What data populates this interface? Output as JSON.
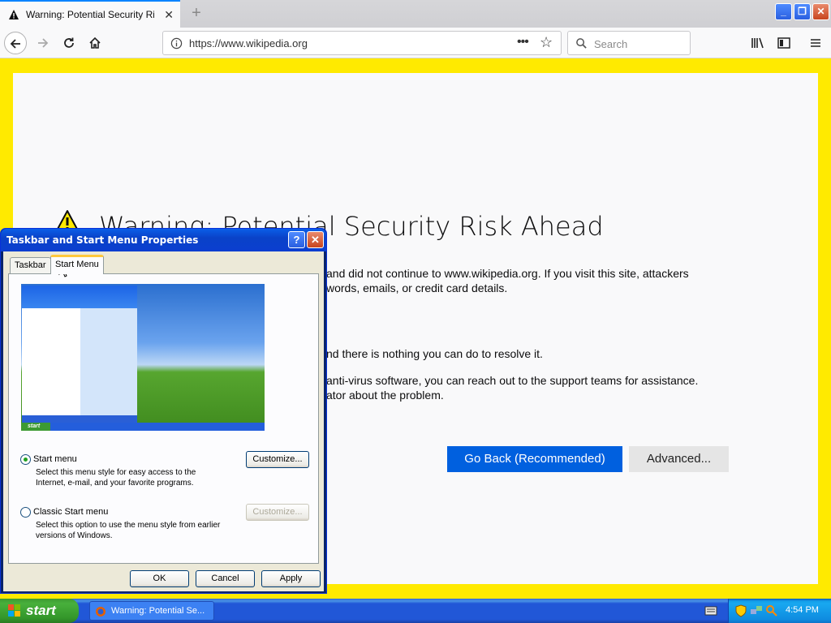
{
  "browser": {
    "tab_title": "Warning: Potential Security Risk Ahead",
    "url": "https://www.wikipedia.org",
    "search_placeholder": "Search",
    "accent": "#0a84ff"
  },
  "warning_page": {
    "title": "Warning: Potential Security Risk Ahead",
    "para1_line1": "and did not continue to www.wikipedia.org. If you visit this site, attackers",
    "para1_line2": "words, emails, or credit card details.",
    "para2": "nd there is nothing you can do to resolve it.",
    "para3_line1": "anti-virus software, you can reach out to the support teams for assistance.",
    "para3_line2": "ator about the problem.",
    "go_back_label": "Go Back (Recommended)",
    "advanced_label": "Advanced..."
  },
  "dialog": {
    "title": "Taskbar and Start Menu Properties",
    "help_label": "?",
    "close_label": "✕",
    "tabs": [
      {
        "label": "Taskbar",
        "selected": false
      },
      {
        "label": "Start Menu",
        "selected": true
      }
    ],
    "preview_start_label": "start",
    "options": [
      {
        "label": "Start menu",
        "desc": "Select this menu style for easy access to the Internet, e-mail, and your favorite programs.",
        "checked": true,
        "button": "Customize...",
        "button_enabled": true
      },
      {
        "label": "Classic Start menu",
        "desc": "Select this option to use the menu style from earlier versions of Windows.",
        "checked": false,
        "button": "Customize...",
        "button_enabled": false
      }
    ],
    "ok_label": "OK",
    "cancel_label": "Cancel",
    "apply_label": "Apply"
  },
  "taskbar": {
    "start_label": "start",
    "task_item": "Warning: Potential Se...",
    "clock": "4:54 PM"
  }
}
